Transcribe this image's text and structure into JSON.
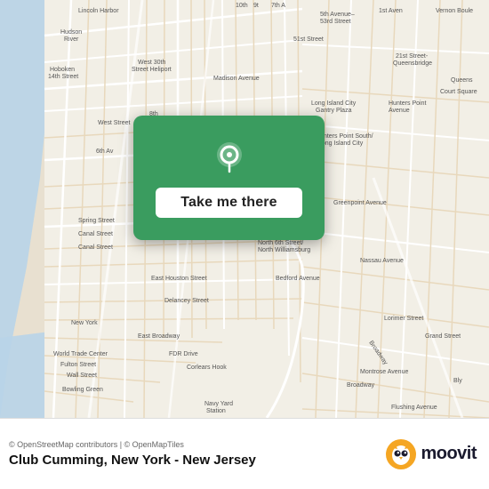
{
  "map": {
    "attribution": "© OpenStreetMap contributors | © OpenMapTiles",
    "venue": "Club Cumming, New York - New Jersey"
  },
  "card": {
    "take_me_there": "Take me there"
  },
  "moovit": {
    "text": "moovit"
  }
}
